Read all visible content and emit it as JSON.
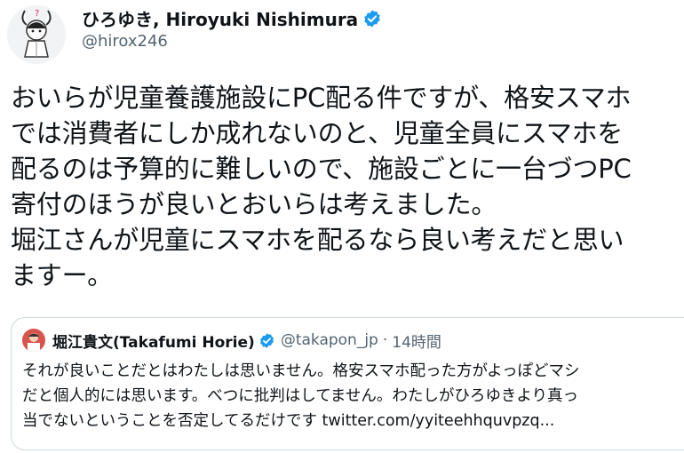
{
  "tweet": {
    "author": {
      "display_name": "ひろゆき, Hiroyuki Nishimura",
      "handle": "@hirox246",
      "verified": true,
      "avatar_icon": "cartoon-avatar-icon"
    },
    "text_lines": [
      "おいらが児童養護施設にPC配る件ですが、格安スマホ",
      "では消費者にしか成れないのと、児童全員にスマホを",
      "配るのは予算的に難しいので、施設ごとに一台づつPC",
      "寄付のほうが良いとおいらは考えました。",
      "堀江さんが児童にスマホを配るなら良い考えだと思い",
      "ますー。"
    ],
    "quoted": {
      "display_name": "堀江貴文(Takafumi Horie)",
      "handle": "@takapon_jp",
      "separator": "·",
      "time": "14時間",
      "verified": true,
      "text_lines": [
        "それが良いことだとはわたしは思いません。格安スマホ配った方がよっぽどマシ",
        "だと個人的には思います。べつに批判はしてません。わたしがひろゆきより真っ",
        "当でないということを否定してるだけです twitter.com/yyiteehhquvpzq..."
      ]
    }
  },
  "colors": {
    "verified_blue": "#1d9bf0",
    "text_primary": "#0f1419",
    "text_secondary": "#536471",
    "border": "#cfd9de"
  }
}
